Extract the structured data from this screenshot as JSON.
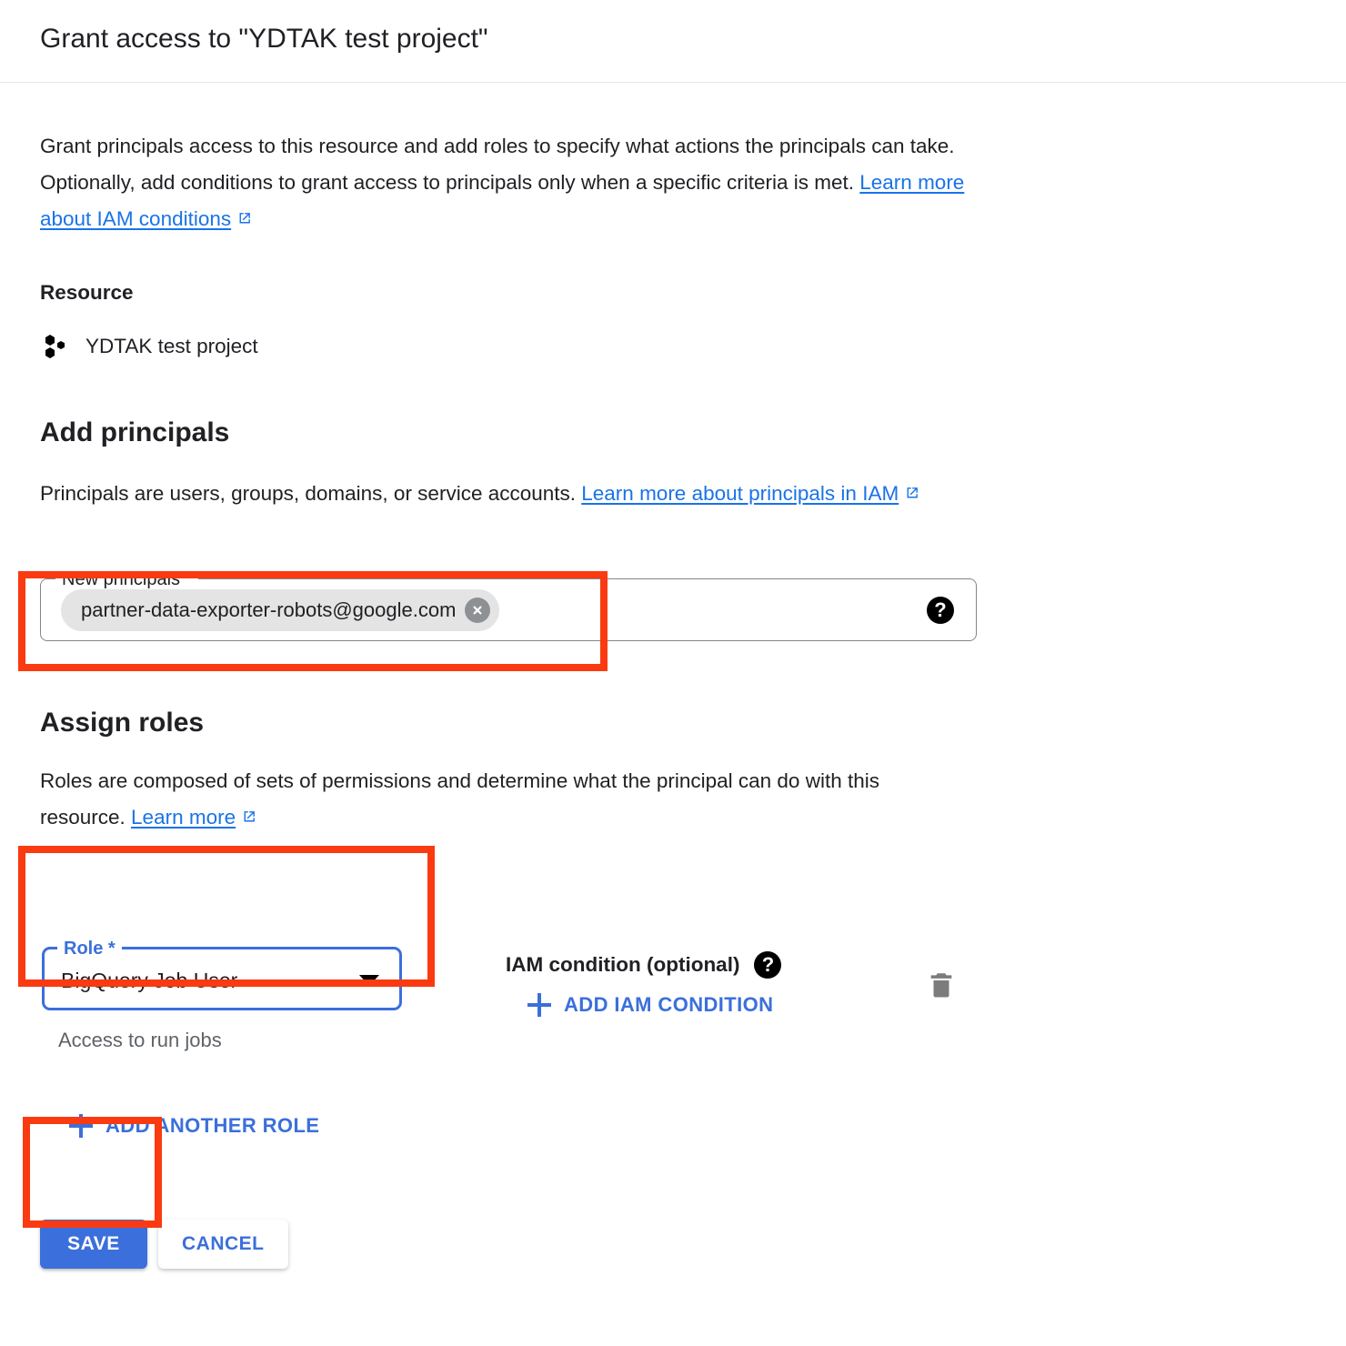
{
  "header": {
    "title": "Grant access to \"YDTAK test project\""
  },
  "intro": {
    "text_before_link": "Grant principals access to this resource and add roles to specify what actions the principals can take. Optionally, add conditions to grant access to principals only when a specific criteria is met. ",
    "link_label": "Learn more about IAM conditions",
    "link_icon": "external-link-icon"
  },
  "resource": {
    "heading": "Resource",
    "icon": "gcp-project-icon",
    "name": "YDTAK test project"
  },
  "add_principals": {
    "heading": "Add principals",
    "helper_before_link": "Principals are users, groups, domains, or service accounts. ",
    "helper_link_label": "Learn more about principals in IAM",
    "helper_link_icon": "external-link-icon",
    "field": {
      "label": "New principals *",
      "chips": [
        {
          "label": "partner-data-exporter-robots@google.com",
          "remove_icon": "close-circle-icon"
        }
      ],
      "help_icon": "help-icon"
    }
  },
  "assign_roles": {
    "heading": "Assign roles",
    "helper_before_link": "Roles are composed of sets of permissions and determine what the principal can do with this resource. ",
    "helper_link_label": "Learn more",
    "helper_link_icon": "external-link-icon",
    "role_field": {
      "label": "Role *",
      "value": "BigQuery Job User",
      "description": "Access to run jobs",
      "dropdown_icon": "chevron-down-icon"
    },
    "condition": {
      "label": "IAM condition (optional)",
      "help_icon": "help-icon",
      "add_label": "ADD IAM CONDITION",
      "add_icon": "plus-icon",
      "delete_icon": "trash-icon"
    },
    "add_another_role_label": "ADD ANOTHER ROLE",
    "add_another_role_icon": "plus-icon"
  },
  "actions": {
    "save_label": "SAVE",
    "cancel_label": "CANCEL"
  },
  "colors": {
    "accent_blue": "#3b6fdb",
    "link_blue": "#1a73e8",
    "annotation_red": "#fa3a11",
    "chip_grey": "#e4e4e4",
    "muted_text": "#5f6368"
  }
}
